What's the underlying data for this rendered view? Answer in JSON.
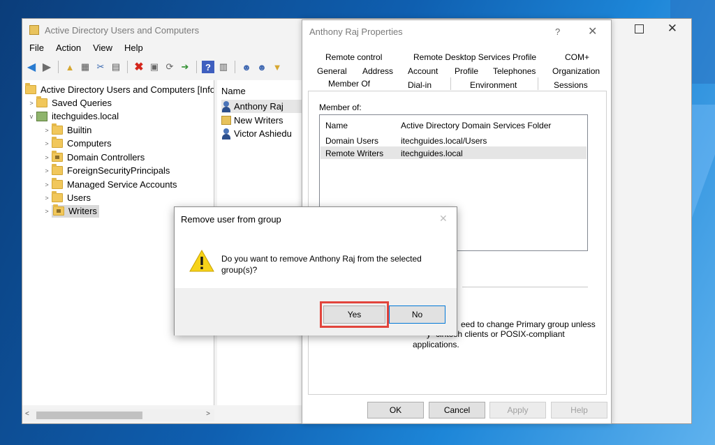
{
  "main_window": {
    "title": "Active Directory Users and Computers",
    "menu": [
      "File",
      "Action",
      "View",
      "Help"
    ],
    "tree": {
      "root": "Active Directory Users and Computers [InfoD",
      "saved_queries": "Saved Queries",
      "domain": "itechguides.local",
      "children": [
        "Builtin",
        "Computers",
        "Domain Controllers",
        "ForeignSecurityPrincipals",
        "Managed Service Accounts",
        "Users",
        "Writers"
      ]
    },
    "list": {
      "header": "Name",
      "items": [
        "Anthony Raj",
        "New Writers",
        "Victor Ashiedu"
      ]
    }
  },
  "properties_dialog": {
    "title": "Anthony Raj Properties",
    "help_glyph": "?",
    "tabs_row1": [
      "Remote control",
      "Remote Desktop Services Profile",
      "COM+"
    ],
    "tabs_row2": [
      "General",
      "Address",
      "Account",
      "Profile",
      "Telephones",
      "Organization"
    ],
    "tabs_row3": [
      "Member Of",
      "Dial-in",
      "Environment",
      "Sessions"
    ],
    "member_of_label": "Member of:",
    "columns": [
      "Name",
      "Active Directory Domain Services Folder"
    ],
    "rows": [
      {
        "name": "Domain Users",
        "folder": "itechguides.local/Users"
      },
      {
        "name": "Remote Writers",
        "folder": "itechguides.local"
      }
    ],
    "note_line1": "eed to change Primary group unless",
    "note_line2": "cintosh clients or POSIX-compliant",
    "note_line3": "applications.",
    "buttons": {
      "ok": "OK",
      "cancel": "Cancel",
      "apply": "Apply",
      "help": "Help"
    }
  },
  "confirm_dialog": {
    "title": "Remove user from group",
    "message_line1": "Do you want to remove Anthony Raj from the selected",
    "message_line2": "group(s)?",
    "yes": "Yes",
    "no": "No"
  },
  "colors": {
    "highlight_box": "#e2453c",
    "accent": "#0078d7",
    "desktop": "#1d86d8"
  }
}
